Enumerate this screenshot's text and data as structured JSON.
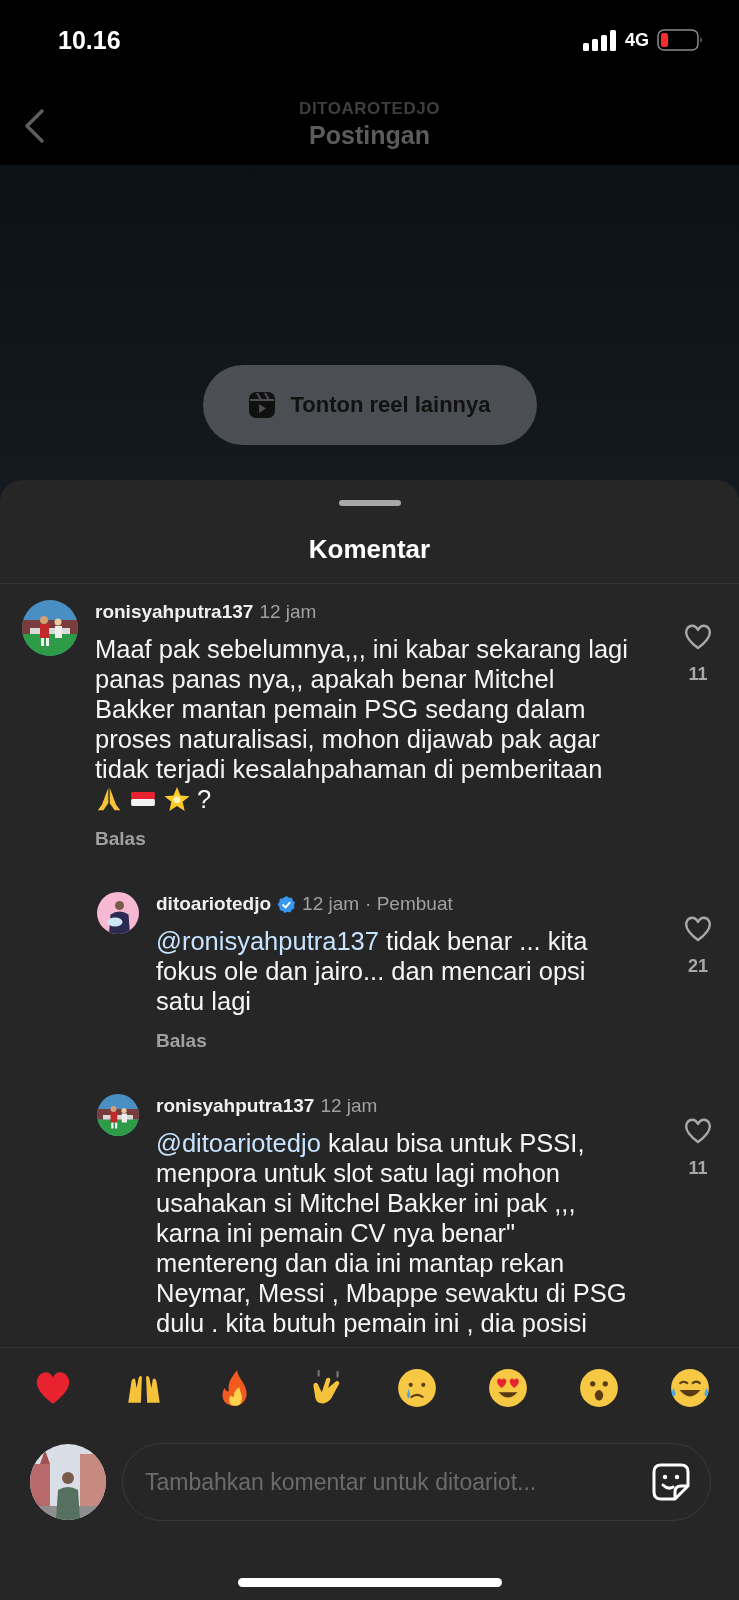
{
  "status_bar": {
    "time": "10.16",
    "network": "4G"
  },
  "header": {
    "account": "DITOAROTEDJO",
    "title": "Postingan"
  },
  "reel_button": {
    "label": "Tonton reel lainnya"
  },
  "sheet": {
    "title": "Komentar"
  },
  "comments": [
    {
      "username": "ronisyahputra137",
      "time": "12 jam",
      "verified": false,
      "body": "Maaf pak sebelumnya,,, ini kabar sekarang lagi panas panas nya,, apakah benar Mitchel Bakker mantan pemain PSG sedang dalam proses naturalisasi, mohon dijawab pak agar tidak terjadi kesalahpahaman di pemberitaan",
      "emojis": [
        {
          "kind": "pray"
        },
        {
          "kind": "flag"
        },
        {
          "kind": "star"
        }
      ],
      "tail": "?",
      "likes": "11",
      "reply": "Balas",
      "is_reply": false
    },
    {
      "username": "ditoariotedjo",
      "time": "12 jam",
      "role": "· Pembuat",
      "verified": true,
      "mention": "@ronisyahputra137",
      "body": "tidak benar ... kita fokus ole dan jairo... dan mencari opsi satu lagi",
      "likes": "21",
      "reply": "Balas",
      "is_reply": true
    },
    {
      "username": "ronisyahputra137",
      "time": "12 jam",
      "verified": false,
      "mention": "@ditoariotedjo",
      "body": "kalau bisa untuk PSSI, menpora untuk slot satu lagi mohon usahakan si Mitchel Bakker ini pak ,,, karna ini pemain CV nya benar\" mentereng dan dia ini mantap rekan Neymar, Messi , Mbappe sewaktu di PSG dulu . kita butuh pemain ini , dia posisi",
      "likes": "11",
      "is_reply": true
    }
  ],
  "reactions": [
    {
      "kind": "heart"
    },
    {
      "kind": "raised-hands"
    },
    {
      "kind": "fire"
    },
    {
      "kind": "clap"
    },
    {
      "kind": "crying"
    },
    {
      "kind": "heart-eyes"
    },
    {
      "kind": "surprised"
    },
    {
      "kind": "joy"
    }
  ],
  "composer": {
    "placeholder": "Tambahkan komentar untuk ditoariot..."
  }
}
